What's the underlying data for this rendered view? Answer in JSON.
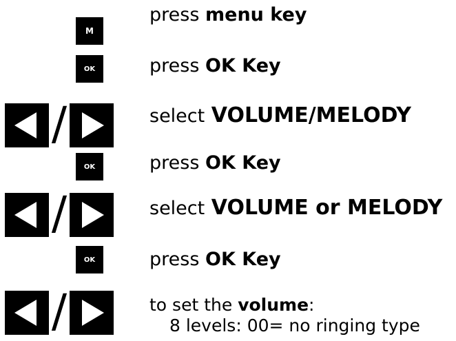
{
  "keys": {
    "menu": "M",
    "ok": "OK"
  },
  "steps": [
    {
      "verb": "press",
      "target": "menu key"
    },
    {
      "verb": "press",
      "target": "OK Key"
    },
    {
      "verb": "select",
      "target": "VOLUME/MELODY"
    },
    {
      "verb": "press",
      "target": "OK Key"
    },
    {
      "verb": "select",
      "target": "VOLUME or MELODY"
    },
    {
      "verb": "press",
      "target": "OK Key"
    },
    {
      "verb": "to set the",
      "target": "volume",
      "suffix": ":"
    }
  ],
  "volume_note": "8 levels: 00= no ringing type"
}
